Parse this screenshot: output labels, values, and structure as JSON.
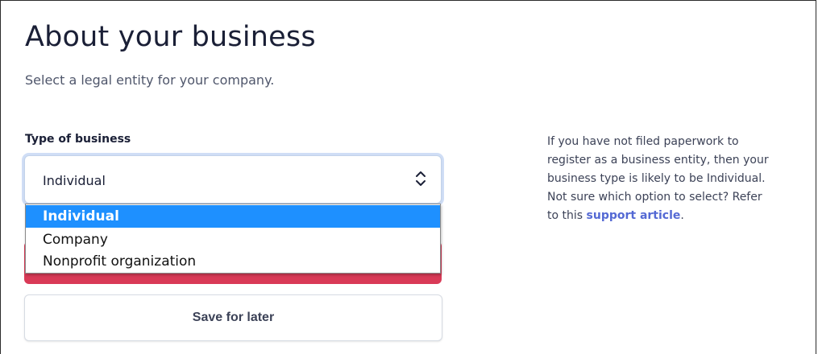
{
  "header": {
    "title": "About your business",
    "subtitle": "Select a legal entity for your company."
  },
  "form": {
    "business_type_label": "Type of business",
    "business_type_value": "Individual",
    "business_type_options": [
      "Individual",
      "Company",
      "Nonprofit organization"
    ],
    "selected_option_index": 0,
    "save_label": "Save for later"
  },
  "help": {
    "text_line1": "If you have not filed paperwork to",
    "text_line2": "register as a business entity, then your",
    "text_line3": "business type is likely to be Individual.",
    "text_line4": "Not sure which option to select? Refer",
    "text_prefix": "to this ",
    "link_text": "support article",
    "text_suffix": "."
  },
  "colors": {
    "highlight": "#1e90ff",
    "link": "#5469d4",
    "error_field": "#d93a57"
  },
  "icons": {
    "select_arrows": "up-down-chevron-icon"
  }
}
